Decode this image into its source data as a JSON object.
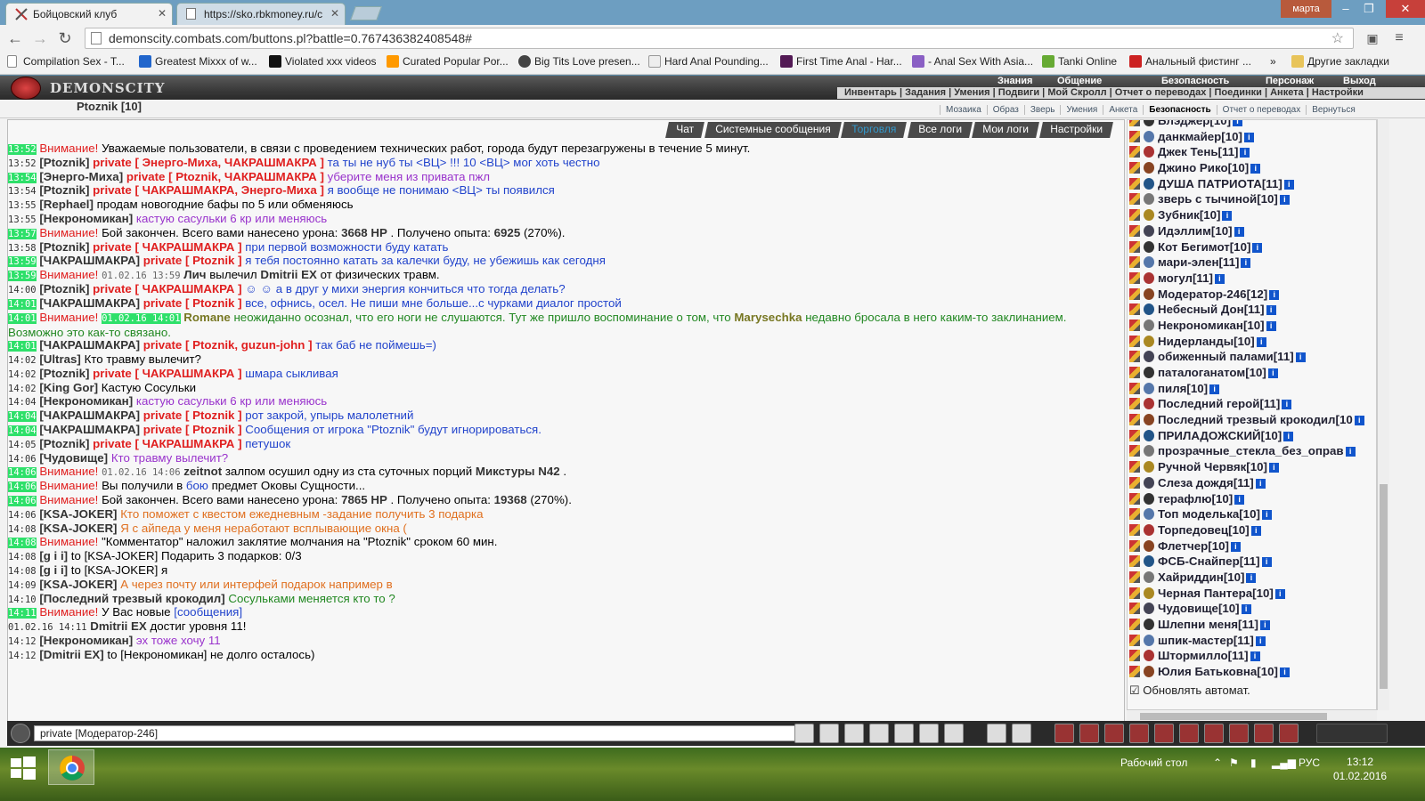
{
  "browser": {
    "tabs": [
      {
        "title": "Бойцовский клуб",
        "active": true
      },
      {
        "title": "https://sko.rbkmoney.ru/c",
        "active": false
      }
    ],
    "user_button": "марта",
    "url": "demonscity.combats.com/buttons.pl?battle=0.767436382408548#",
    "bookmarks": [
      "Compilation Sex - T...",
      "Greatest Mixxx of w...",
      "Violated xxx videos",
      "Curated Popular Por...",
      "Big Tits Love presen...",
      "Hard Anal Pounding...",
      "First Time Anal - Har...",
      "- Anal Sex With Asia...",
      "Tanki Online",
      "Анальный фистинг ...",
      "Другие закладки"
    ],
    "bookmarks_more": "»"
  },
  "game": {
    "logo": "DEMONSCITY",
    "top_menu": [
      "Знания",
      "Общение",
      "Безопасность",
      "Персонаж",
      "Выход"
    ],
    "sub_menu": "Инвентарь | Задания | Умения | Подвиги | Мой Скролл | Отчет о переводах | Поединки | Анкета | Настройки",
    "player_name": "Ptoznik [10]",
    "top_links": [
      "Мозаика",
      "Образ",
      "Зверь",
      "Умения",
      "Анкета",
      "Безопасность",
      "Отчет о переводах",
      "Вернуться"
    ],
    "chat_tabs": [
      "Чат",
      "Системные сообщения",
      "Торговля",
      "Все логи",
      "Мои логи",
      "Настройки"
    ],
    "input_value": "private [Модератор-246]",
    "auto_refresh": "Обновлять автомат."
  },
  "chat": [
    {
      "t": "13:52",
      "hl": true,
      "parts": [
        [
          "warn",
          "Внимание!"
        ],
        [
          "",
          "Уважаемые пользователи, в связи с проведением технических работ, города будут перезагружены в течение 5 минут."
        ]
      ]
    },
    {
      "t": "13:52",
      "parts": [
        [
          "nick",
          "[Ptoznik]"
        ],
        [
          "priv",
          "private [ Энерго-Миха, ЧАКРАШМАКРА ]"
        ],
        [
          "blue",
          "та ты не нуб ты <ВЦ> !!! 10 <ВЦ> мог хоть честно"
        ]
      ]
    },
    {
      "t": "13:54",
      "hl": true,
      "parts": [
        [
          "nick",
          "[Энерго-Миха]"
        ],
        [
          "priv",
          "private [ Ptoznik, ЧАКРАШМАКРА ]"
        ],
        [
          "purple",
          "уберите меня из привата пжл"
        ]
      ]
    },
    {
      "t": "13:54",
      "parts": [
        [
          "nick",
          "[Ptoznik]"
        ],
        [
          "priv",
          "private [ ЧАКРАШМАКРА, Энерго-Миха ]"
        ],
        [
          "blue",
          "я вообще не понимаю <ВЦ> ты появился"
        ]
      ]
    },
    {
      "t": "13:55",
      "parts": [
        [
          "nick",
          "[Rephael]"
        ],
        [
          "",
          "продам новогодние бафы по 5 или обменяюсь"
        ]
      ]
    },
    {
      "t": "13:55",
      "parts": [
        [
          "nick",
          "[Некрономикан]"
        ],
        [
          "purple",
          "кастую сасульки 6 кр или меняюсь"
        ]
      ]
    },
    {
      "t": "13:57",
      "hl": true,
      "parts": [
        [
          "warn",
          "Внимание!"
        ],
        [
          "",
          "Бой закончен. Всего вами нанесено урона:"
        ],
        [
          "nick",
          "3668 HP"
        ],
        [
          "",
          ". Получено опыта:"
        ],
        [
          "nick",
          "6925"
        ],
        [
          "",
          "(270%)."
        ]
      ]
    },
    {
      "t": "13:58",
      "parts": [
        [
          "nick",
          "[Ptoznik]"
        ],
        [
          "priv",
          "private [ ЧАКРАШМАКРА ]"
        ],
        [
          "blue",
          "при первой возможности буду катать"
        ]
      ]
    },
    {
      "t": "13:59",
      "hl": true,
      "parts": [
        [
          "nick",
          "[ЧАКРАШМАКРА]"
        ],
        [
          "priv",
          "private [ Ptoznik ]"
        ],
        [
          "blue",
          "я тебя постоянно катать за калечки буду, не убежишь как сегодня"
        ]
      ]
    },
    {
      "t": "13:59",
      "hl": true,
      "parts": [
        [
          "warn",
          "Внимание!"
        ],
        [
          "sd",
          "01.02.16 13:59"
        ],
        [
          "nick",
          "Лич"
        ],
        [
          "",
          "вылечил"
        ],
        [
          "nick",
          "Dmitrii EX"
        ],
        [
          "",
          "от физических травм."
        ]
      ]
    },
    {
      "t": "14:00",
      "parts": [
        [
          "nick",
          "[Ptoznik]"
        ],
        [
          "priv",
          "private [ ЧАКРАШМАКРА ]"
        ],
        [
          "blue",
          "☺ ☺ а в друг у михи энергия кончиться что тогда делать?"
        ]
      ]
    },
    {
      "t": "14:01",
      "hl": true,
      "parts": [
        [
          "nick",
          "[ЧАКРАШМАКРА]"
        ],
        [
          "priv",
          "private [ Ptoznik ]"
        ],
        [
          "blue",
          "все, офнись, осел. Не пиши мне больше...с чурками диалог простой"
        ]
      ]
    },
    {
      "t": "14:01",
      "hl": true,
      "wrap": true,
      "parts": [
        [
          "warn",
          "Внимание!"
        ],
        [
          "sdhl",
          "01.02.16 14:01"
        ],
        [
          "olive",
          "Romane"
        ],
        [
          "green",
          "неожиданно осознал, что его ноги не слушаются. Тут же пришло воспоминание о том, что"
        ],
        [
          "olive",
          "Marysechka"
        ],
        [
          "green",
          "недавно бросала в него каким-то заклинанием. Возможно это как-то связано."
        ]
      ]
    },
    {
      "t": "14:01",
      "hl": true,
      "parts": [
        [
          "nick",
          "[ЧАКРАШМАКРА]"
        ],
        [
          "priv",
          "private [ Ptoznik, guzun-john ]"
        ],
        [
          "blue",
          "так баб не поймешь=)"
        ]
      ]
    },
    {
      "t": "14:02",
      "parts": [
        [
          "nick",
          "[Ultras]"
        ],
        [
          "",
          "Кто травму вылечит?"
        ]
      ]
    },
    {
      "t": "14:02",
      "parts": [
        [
          "nick",
          "[Ptoznik]"
        ],
        [
          "priv",
          "private [ ЧАКРАШМАКРА ]"
        ],
        [
          "blue",
          "шмара сыкливая"
        ]
      ]
    },
    {
      "t": "14:02",
      "parts": [
        [
          "nick",
          "[King Gor]"
        ],
        [
          "",
          "Кастую Сосульки"
        ]
      ]
    },
    {
      "t": "14:04",
      "parts": [
        [
          "nick",
          "[Некрономикан]"
        ],
        [
          "purple",
          "кастую сасульки 6 кр или меняюсь"
        ]
      ]
    },
    {
      "t": "14:04",
      "hl": true,
      "parts": [
        [
          "nick",
          "[ЧАКРАШМАКРА]"
        ],
        [
          "priv",
          "private [ Ptoznik ]"
        ],
        [
          "blue",
          "рот закрой, упырь малолетний"
        ]
      ]
    },
    {
      "t": "14:04",
      "hl": true,
      "parts": [
        [
          "nick",
          "[ЧАКРАШМАКРА]"
        ],
        [
          "priv",
          "private [ Ptoznik ]"
        ],
        [
          "blue",
          "Сообщения от игрока \"Ptoznik\" будут игнорироваться."
        ]
      ]
    },
    {
      "t": "14:05",
      "parts": [
        [
          "nick",
          "[Ptoznik]"
        ],
        [
          "priv",
          "private [ ЧАКРАШМАКРА ]"
        ],
        [
          "blue",
          "петушок"
        ]
      ]
    },
    {
      "t": "14:06",
      "parts": [
        [
          "nick",
          "[Чудовище]"
        ],
        [
          "purple",
          "Кто травму вылечит?"
        ]
      ]
    },
    {
      "t": "14:06",
      "hl": true,
      "parts": [
        [
          "warn",
          "Внимание!"
        ],
        [
          "sd",
          "01.02.16 14:06"
        ],
        [
          "nick",
          "zeitnot"
        ],
        [
          "",
          "залпом осушил одну из ста суточных порций"
        ],
        [
          "nick",
          "Микстуры N42"
        ],
        [
          "",
          "."
        ]
      ]
    },
    {
      "t": "14:06",
      "hl": true,
      "parts": [
        [
          "warn",
          "Внимание!"
        ],
        [
          "",
          "Вы получили в"
        ],
        [
          "blue",
          "бою"
        ],
        [
          "",
          "предмет Оковы Сущности..."
        ]
      ]
    },
    {
      "t": "14:06",
      "hl": true,
      "parts": [
        [
          "warn",
          "Внимание!"
        ],
        [
          "",
          "Бой закончен. Всего вами нанесено урона:"
        ],
        [
          "nick",
          "7865 HP"
        ],
        [
          "",
          ". Получено опыта:"
        ],
        [
          "nick",
          "19368"
        ],
        [
          "",
          "(270%)."
        ]
      ]
    },
    {
      "t": "14:06",
      "parts": [
        [
          "nick",
          "[KSA-JOKER]"
        ],
        [
          "orange",
          "Кто поможет с квестом ежедневным -задание получить 3 подарка"
        ]
      ]
    },
    {
      "t": "14:08",
      "parts": [
        [
          "nick",
          "[KSA-JOKER]"
        ],
        [
          "orange",
          "Я с айпеда у меня неработают всплывающие окна ("
        ]
      ]
    },
    {
      "t": "14:08",
      "hl": true,
      "parts": [
        [
          "warn",
          "Внимание!"
        ],
        [
          "",
          "\"Комментатор\" наложил заклятие молчания на \"Ptoznik\" сроком 60 мин."
        ]
      ]
    },
    {
      "t": "14:08",
      "parts": [
        [
          "nick",
          "[g i i]"
        ],
        [
          "",
          "to [KSA-JOKER] Подарить 3 подарков: 0/3"
        ]
      ]
    },
    {
      "t": "14:08",
      "parts": [
        [
          "nick",
          "[g i i]"
        ],
        [
          "",
          "to [KSA-JOKER] я"
        ]
      ]
    },
    {
      "t": "14:09",
      "parts": [
        [
          "nick",
          "[KSA-JOKER]"
        ],
        [
          "orange",
          "А через почту или интерфей подарок например в"
        ]
      ]
    },
    {
      "t": "14:10",
      "parts": [
        [
          "nick",
          "[Последний трезвый крокодил]"
        ],
        [
          "green",
          "Сосульками меняется кто то ?"
        ]
      ]
    },
    {
      "t": "14:11",
      "hl": true,
      "parts": [
        [
          "warn",
          "Внимание!"
        ],
        [
          "",
          "У Вас новые"
        ],
        [
          "blue",
          "[сообщения]"
        ]
      ]
    },
    {
      "t": "01.02.16 14:11",
      "parts": [
        [
          "nick",
          "Dmitrii EX"
        ],
        [
          "",
          "достиг уровня 11!"
        ]
      ]
    },
    {
      "t": "14:12",
      "parts": [
        [
          "nick",
          "[Некрономикан]"
        ],
        [
          "purple",
          "эх тоже хочу 11"
        ]
      ]
    },
    {
      "t": "14:12",
      "parts": [
        [
          "nick",
          "[Dmitrii EX]"
        ],
        [
          "",
          "to [Некрономикан] не долго осталось)"
        ]
      ]
    }
  ],
  "users": [
    {
      "name": "Блэджер",
      "lvl": "[10]"
    },
    {
      "name": "данкмайер",
      "lvl": "[10]"
    },
    {
      "name": "Джек Тень",
      "lvl": "[11]"
    },
    {
      "name": "Джино Рико",
      "lvl": "[10]"
    },
    {
      "name": "ДУША ПАТРИОТА",
      "lvl": "[11]"
    },
    {
      "name": "зверь с тычиной",
      "lvl": "[10]"
    },
    {
      "name": "Зубник",
      "lvl": "[10]"
    },
    {
      "name": "Идэллим",
      "lvl": "[10]"
    },
    {
      "name": "Кот Бегимот",
      "lvl": "[10]"
    },
    {
      "name": "мари-элен",
      "lvl": "[11]"
    },
    {
      "name": "могул",
      "lvl": "[11]"
    },
    {
      "name": "Модератор-246",
      "lvl": "[12]"
    },
    {
      "name": "Небесный Дон",
      "lvl": "[11]"
    },
    {
      "name": "Некрономикан",
      "lvl": "[10]"
    },
    {
      "name": "Нидерланды",
      "lvl": "[10]"
    },
    {
      "name": "обиженный палами",
      "lvl": "[11]"
    },
    {
      "name": "паталоганатом",
      "lvl": "[10]"
    },
    {
      "name": "пиля",
      "lvl": "[10]"
    },
    {
      "name": "Последний герой",
      "lvl": "[11]"
    },
    {
      "name": "Последний трезвый крокодил",
      "lvl": "[10"
    },
    {
      "name": "ПРИЛАДОЖСКИЙ",
      "lvl": "[10]"
    },
    {
      "name": "прозрачные_стекла_без_оправ",
      "lvl": ""
    },
    {
      "name": "Ручной Червяк",
      "lvl": "[10]"
    },
    {
      "name": "Слеза дождя",
      "lvl": "[11]"
    },
    {
      "name": "терафлю",
      "lvl": "[10]"
    },
    {
      "name": "Топ моделька",
      "lvl": "[10]"
    },
    {
      "name": "Торпедовец",
      "lvl": "[10]"
    },
    {
      "name": "Флетчер",
      "lvl": "[10]"
    },
    {
      "name": "ФСБ-Снайпер",
      "lvl": "[11]"
    },
    {
      "name": "Хайриддин",
      "lvl": "[10]"
    },
    {
      "name": "Черная Пантера",
      "lvl": "[10]"
    },
    {
      "name": "Чудовище",
      "lvl": "[10]"
    },
    {
      "name": "Шлепни меня",
      "lvl": "[11]"
    },
    {
      "name": "шпик-мастер",
      "lvl": "[11]"
    },
    {
      "name": "Штормилло",
      "lvl": "[11]"
    },
    {
      "name": "Юлия Батьковна",
      "lvl": "[10]"
    }
  ],
  "taskbar": {
    "desktop_label": "Рабочий стол",
    "lang": "РУС",
    "time": "13:12",
    "date": "01.02.2016"
  },
  "colors": {
    "highlight_time": "#2ee06a",
    "private": "#e02020",
    "page_bg": "#f2f2f2"
  }
}
